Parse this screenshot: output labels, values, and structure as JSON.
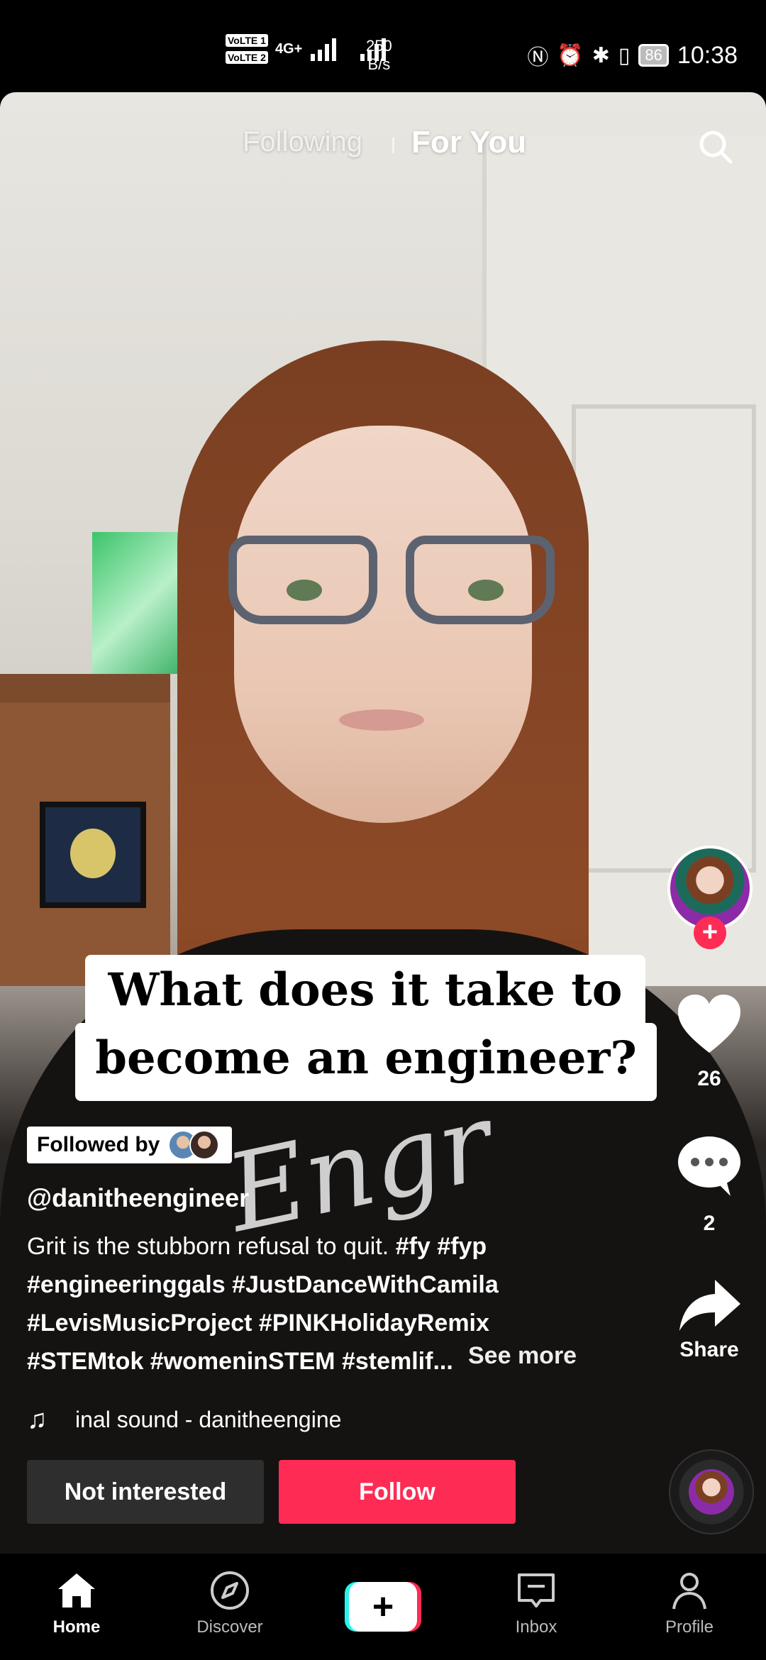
{
  "status_bar": {
    "volte1": "VoLTE 1",
    "volte2": "VoLTE 2",
    "network": "4G+",
    "net_speed_value": "250",
    "net_speed_unit": "B/s",
    "battery": "86",
    "time": "10:38"
  },
  "top_nav": {
    "following_label": "Following",
    "for_you_label": "For You"
  },
  "video": {
    "caption_line1": "What does it take to",
    "caption_line2": "become an engineer?"
  },
  "rail": {
    "like_count": "26",
    "comment_count": "2",
    "share_label": "Share"
  },
  "post": {
    "followed_by_label": "Followed by",
    "username": "@danitheengineer",
    "desc_text": "Grit is the stubborn refusal to quit.",
    "hashtags_line1": "#fy #fyp",
    "hashtags_line2": "#engineeringgals #JustDanceWithCamila",
    "hashtags_line3": "#LevisMusicProject #PINKHolidayRemix",
    "hashtags_line4": "#STEMtok #womeninSTEM #stemlif...",
    "see_more": "See more",
    "music": "inal sound - danitheengine"
  },
  "actions": {
    "not_interested": "Not interested",
    "follow": "Follow"
  },
  "bottom_nav": {
    "home": "Home",
    "discover": "Discover",
    "inbox": "Inbox",
    "profile": "Profile"
  },
  "colors": {
    "accent": "#fe2c55",
    "cyan": "#25f4ee"
  }
}
